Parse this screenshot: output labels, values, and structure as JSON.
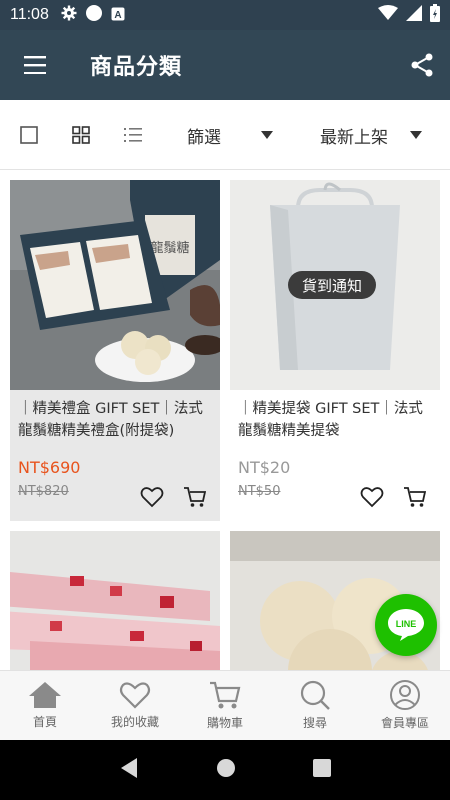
{
  "status_bar": {
    "time": "11:08"
  },
  "app_bar": {
    "title": "商品分類"
  },
  "toolbar": {
    "filter_label": "篩選",
    "sort_label": "最新上架"
  },
  "products": [
    {
      "name": "｜精美禮盒 GIFT SET｜法式龍鬚糖精美禮盒(附提袋)",
      "price": "NT$690",
      "original_price": "NT$820",
      "badge": ""
    },
    {
      "name": "｜精美提袋 GIFT SET｜法式龍鬚糖精美提袋",
      "price": "NT$20",
      "original_price": "NT$50",
      "badge": "貨到通知"
    },
    {
      "name": "",
      "price": "",
      "original_price": "",
      "badge": ""
    },
    {
      "name": "",
      "price": "",
      "original_price": "",
      "badge": ""
    }
  ],
  "box_text": "龍鬚糖",
  "line_button": {
    "label": "LINE"
  },
  "bottom_nav": [
    {
      "label": "首頁",
      "icon": "home-icon"
    },
    {
      "label": "我的收藏",
      "icon": "heart-icon"
    },
    {
      "label": "購物車",
      "icon": "cart-icon"
    },
    {
      "label": "搜尋",
      "icon": "search-icon"
    },
    {
      "label": "會員專區",
      "icon": "user-icon"
    }
  ],
  "colors": {
    "app_bar": "#324755",
    "price_sale": "#e8541e",
    "price_soldout": "#999999",
    "line_green": "#1ec000"
  }
}
